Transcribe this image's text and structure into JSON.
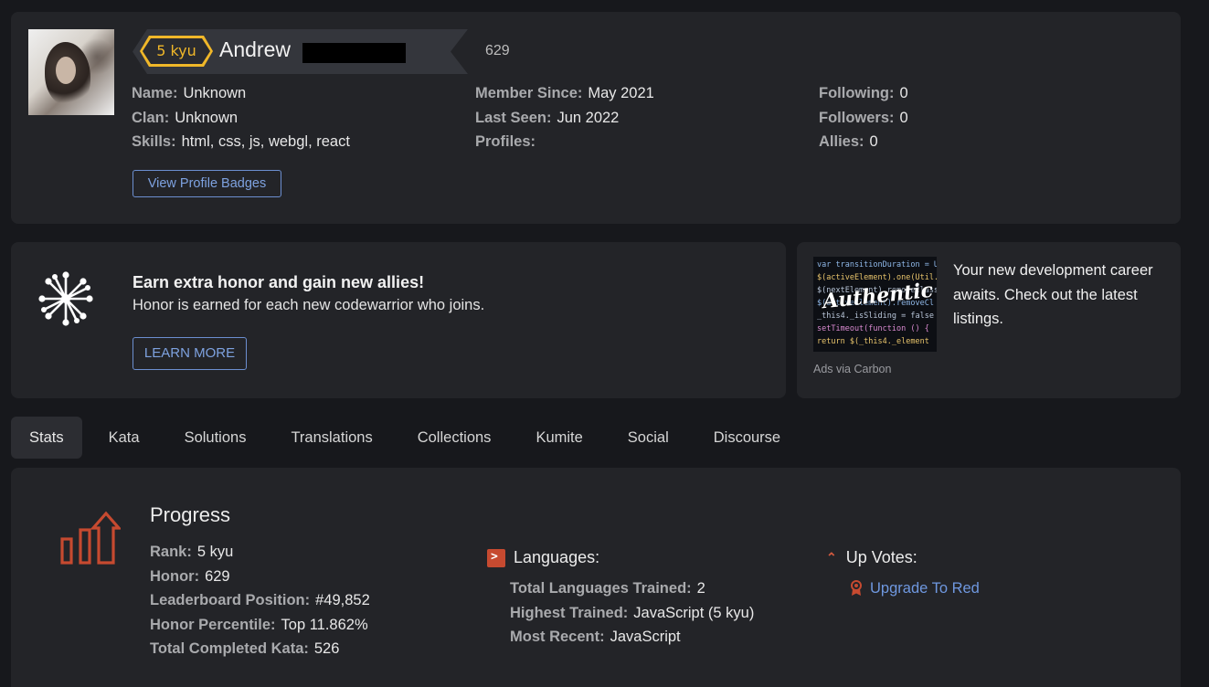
{
  "profile": {
    "rank": "5 kyu",
    "username": "Andrew",
    "honor": "629",
    "columns": [
      [
        {
          "label": "Name:",
          "value": "Unknown"
        },
        {
          "label": "Clan:",
          "value": "Unknown"
        },
        {
          "label": "Skills:",
          "value": "html, css, js, webgl, react"
        }
      ],
      [
        {
          "label": "Member Since:",
          "value": "May 2021"
        },
        {
          "label": "Last Seen:",
          "value": "Jun 2022"
        },
        {
          "label": "Profiles:",
          "value": ""
        }
      ],
      [
        {
          "label": "Following:",
          "value": "0"
        },
        {
          "label": "Followers:",
          "value": "0"
        },
        {
          "label": "Allies:",
          "value": "0"
        }
      ]
    ],
    "view_badges_label": "View Profile Badges"
  },
  "referral": {
    "title": "Earn extra honor and gain new allies!",
    "text": "Honor is earned for each new codewarrior who joins.",
    "button_label": "LEARN MORE"
  },
  "ad": {
    "text": "Your new development career awaits. Check out the latest listings.",
    "via": "Ads via Carbon",
    "logo_text": "Authentic",
    "code_lines": [
      "var transitionDuration = Util",
      "$(activeElement).one(Util.TR",
      "$(nextElement).removeClass",
      "$(activeElement).removeCl",
      "_this4._isSliding = false",
      "setTimeout(function () {",
      "  return $(_this4._element"
    ]
  },
  "tabs": [
    {
      "label": "Stats",
      "active": true
    },
    {
      "label": "Kata",
      "active": false
    },
    {
      "label": "Solutions",
      "active": false
    },
    {
      "label": "Translations",
      "active": false
    },
    {
      "label": "Collections",
      "active": false
    },
    {
      "label": "Kumite",
      "active": false
    },
    {
      "label": "Social",
      "active": false
    },
    {
      "label": "Discourse",
      "active": false
    }
  ],
  "stats": {
    "progress_title": "Progress",
    "progress": [
      {
        "label": "Rank:",
        "value": "5 kyu"
      },
      {
        "label": "Honor:",
        "value": "629"
      },
      {
        "label": "Leaderboard Position:",
        "value": "#49,852"
      },
      {
        "label": "Honor Percentile:",
        "value": "Top 11.862%"
      },
      {
        "label": "Total Completed Kata:",
        "value": "526"
      }
    ],
    "languages_title": "Languages:",
    "languages": [
      {
        "label": "Total Languages Trained:",
        "value": "2"
      },
      {
        "label": "Highest Trained:",
        "value": "JavaScript (5 kyu)"
      },
      {
        "label": "Most Recent:",
        "value": "JavaScript"
      }
    ],
    "upvotes_title": "Up Votes:",
    "upgrade_link": "Upgrade To Red"
  },
  "colors": {
    "background": "#17181c",
    "panel": "#232428",
    "rank_yellow": "#f0b729",
    "accent_blue": "#6f98e0",
    "accent_red": "#c64a30"
  },
  "icons": [
    "network-icon",
    "progress-chart-icon",
    "terminal-icon",
    "chevron-up-icon",
    "medal-icon"
  ]
}
